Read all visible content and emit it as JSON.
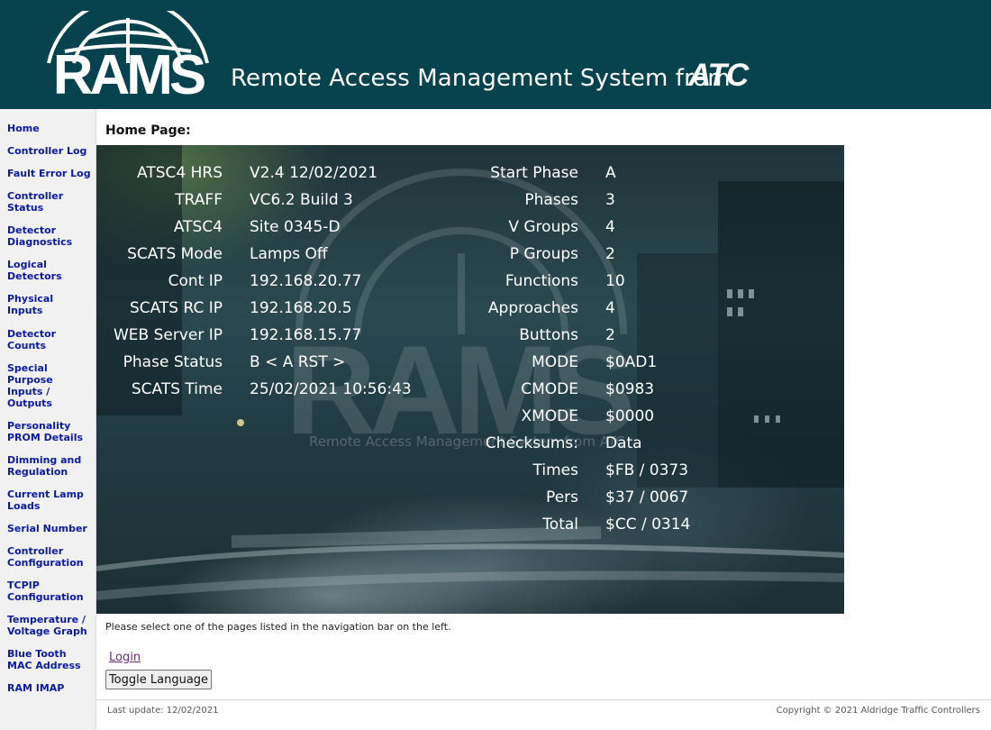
{
  "header": {
    "logo_text": "RAMS",
    "tagline": "Remote Access Management System from",
    "brand": "ATC"
  },
  "sidebar": {
    "items": [
      {
        "label": "Home"
      },
      {
        "label": "Controller Log"
      },
      {
        "label": "Fault Error Log"
      },
      {
        "label": "Controller\nStatus"
      },
      {
        "label": "Detector\nDiagnostics"
      },
      {
        "label": "Logical\nDetectors"
      },
      {
        "label": "Physical\nInputs"
      },
      {
        "label": "Detector\nCounts"
      },
      {
        "label": "Special\nPurpose\nInputs /\nOutputs"
      },
      {
        "label": "Personality\nPROM Details"
      },
      {
        "label": "Dimming and\nRegulation"
      },
      {
        "label": "Current Lamp\nLoads"
      },
      {
        "label": "Serial Number"
      },
      {
        "label": "Controller\nConfiguration"
      },
      {
        "label": "TCPIP\nConfiguration"
      },
      {
        "label": "Temperature /\nVoltage Graph"
      },
      {
        "label": "Blue Tooth\nMAC Address"
      },
      {
        "label": "RAM IMAP"
      }
    ]
  },
  "main": {
    "title": "Home Page:",
    "watermark": {
      "logo": "RAMS",
      "tagline": "Remote Access Management System from ATC"
    },
    "left_rows": [
      {
        "label": "ATSC4 HRS",
        "value": "V2.4 12/02/2021"
      },
      {
        "label": "TRAFF",
        "value": "VC6.2 Build 3"
      },
      {
        "label": "ATSC4",
        "value": "Site 0345-D"
      },
      {
        "label": "SCATS Mode",
        "value": "Lamps Off"
      },
      {
        "label": "Cont IP",
        "value": "192.168.20.77"
      },
      {
        "label": "SCATS RC IP",
        "value": "192.168.20.5"
      },
      {
        "label": "WEB Server IP",
        "value": "192.168.15.77"
      },
      {
        "label": "Phase Status",
        "value": "B < A RST >"
      },
      {
        "label": "SCATS Time",
        "value": "25/02/2021 10:56:43"
      }
    ],
    "right_rows": [
      {
        "label": "Start Phase",
        "value": "A"
      },
      {
        "label": "Phases",
        "value": "3"
      },
      {
        "label": "V Groups",
        "value": "4"
      },
      {
        "label": "P Groups",
        "value": "2"
      },
      {
        "label": "Functions",
        "value": "10"
      },
      {
        "label": "Approaches",
        "value": "4"
      },
      {
        "label": "Buttons",
        "value": "2"
      },
      {
        "label": "MODE",
        "value": "$0AD1"
      },
      {
        "label": "CMODE",
        "value": "$0983"
      },
      {
        "label": "XMODE",
        "value": "$0000"
      },
      {
        "label": "Checksums:",
        "value": "Data"
      },
      {
        "label": "Times",
        "value": "$FB / 0373"
      },
      {
        "label": "Pers",
        "value": "$37 / 0067"
      },
      {
        "label": "Total",
        "value": "$CC / 0314"
      }
    ],
    "note": "Please select one of the pages listed in the navigation bar on the left.",
    "login_label": "Login",
    "toggle_label": "Toggle Language"
  },
  "footer": {
    "last_update": "Last update: 12/02/2021",
    "copyright": "Copyright © 2021 Aldridge Traffic Controllers"
  },
  "colors": {
    "header_bg": "#06434f",
    "nav_link": "#0a1aa6",
    "sidebar_bg": "#f1f1f1"
  }
}
